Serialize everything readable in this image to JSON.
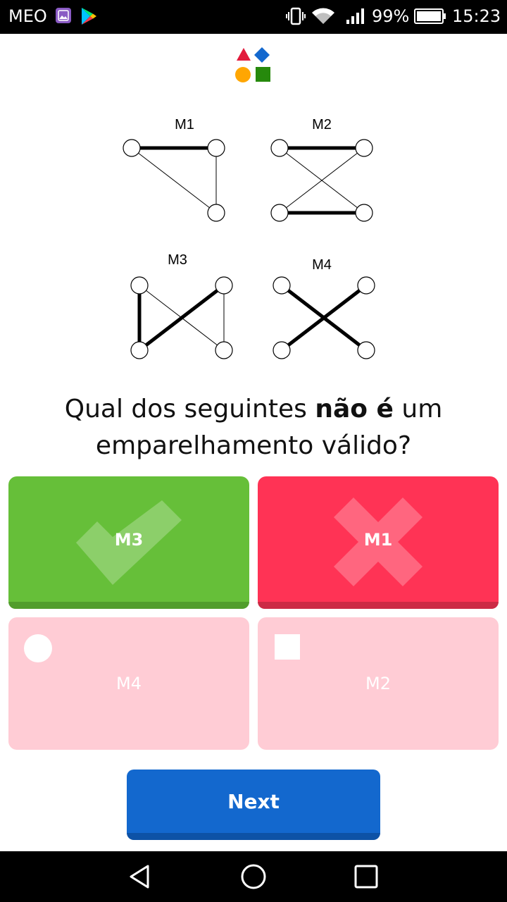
{
  "status_bar": {
    "carrier": "MEO",
    "battery": "99%",
    "time": "15:23",
    "icons": [
      "gallery-icon",
      "play-store-icon",
      "vibrate-icon",
      "wifi-icon",
      "signal-icon",
      "battery-icon"
    ]
  },
  "logo": {
    "icon": "kahoot-shapes-logo",
    "colors": [
      "#e21b3c",
      "#1368ce",
      "#ffa602",
      "#26890c"
    ]
  },
  "graphs": [
    {
      "label": "M1"
    },
    {
      "label": "M2"
    },
    {
      "label": "M3"
    },
    {
      "label": "M4"
    }
  ],
  "question": {
    "part1": "Qual dos seguintes ",
    "bold": "não é",
    "part2": " um emparelhamento válido?"
  },
  "answers": [
    {
      "label": "M3",
      "state": "correct",
      "icon": "check-icon",
      "color": "#66bf39"
    },
    {
      "label": "M1",
      "state": "wrong",
      "icon": "cross-icon",
      "color": "#ff3355"
    },
    {
      "label": "M4",
      "state": "faded",
      "icon": "circle-icon",
      "color": "#ffccd5"
    },
    {
      "label": "M2",
      "state": "faded",
      "icon": "square-icon",
      "color": "#ffccd5"
    }
  ],
  "next_button": {
    "label": "Next",
    "color": "#1368ce"
  },
  "nav_bar": {
    "icons": [
      "back-icon",
      "home-icon",
      "recents-icon"
    ]
  }
}
